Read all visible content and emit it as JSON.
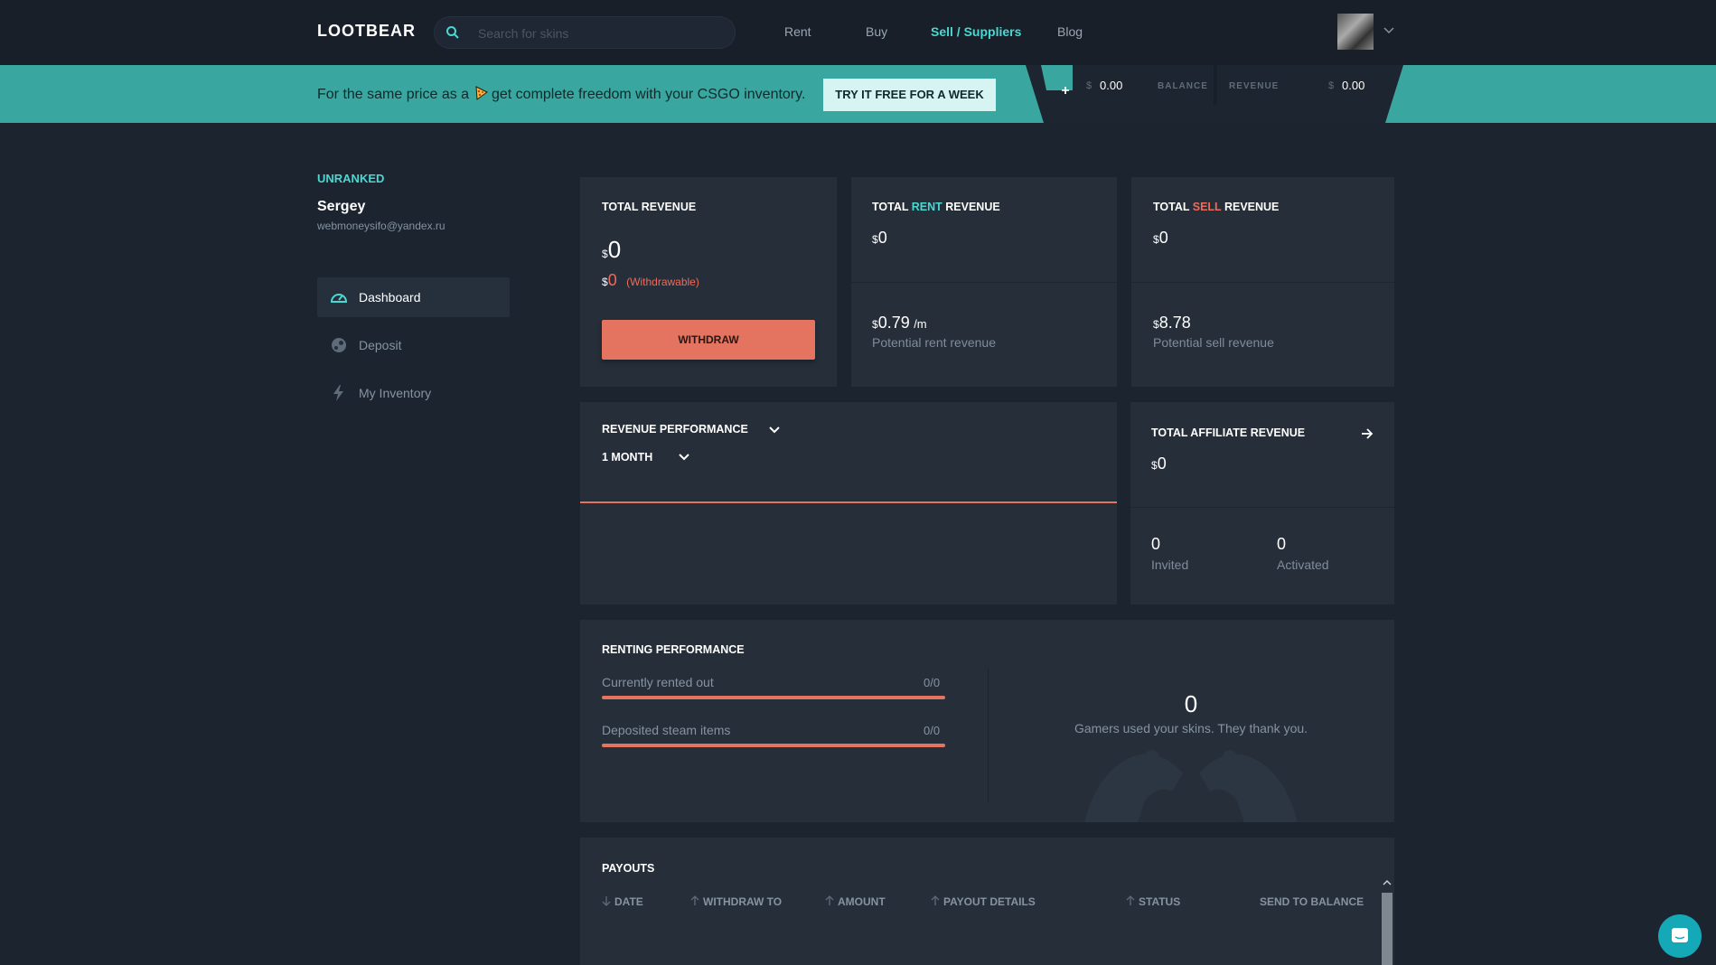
{
  "brand": {
    "logo": "LOOTBEAR"
  },
  "search": {
    "placeholder": "Search for skins"
  },
  "nav": {
    "items": [
      "Rent",
      "Buy",
      "Sell / Suppliers",
      "Blog"
    ]
  },
  "promo": {
    "text_before": "For the same price as a",
    "text_after": "get complete freedom with your CSGO inventory.",
    "button": "TRY IT FREE FOR A WEEK"
  },
  "wallet": {
    "plus": "+",
    "currency": "$",
    "balance_value": "0.00",
    "balance_label": "BALANCE",
    "revenue_label": "REVENUE",
    "revenue_value": "0.00"
  },
  "user": {
    "rank": "UNRANKED",
    "name": "Sergey",
    "email": "webmoneysifo@yandex.ru"
  },
  "sidebar": {
    "items": [
      "Dashboard",
      "Deposit",
      "My Inventory"
    ]
  },
  "total_revenue": {
    "title": "TOTAL REVENUE",
    "currency": "$",
    "value": "0",
    "withdrawable_value": "0",
    "withdrawable_label": "(Withdrawable)",
    "button": "WITHDRAW"
  },
  "rent_revenue": {
    "title_prefix": "TOTAL ",
    "title_accent": "RENT",
    "title_suffix": " REVENUE",
    "currency": "$",
    "value": "0",
    "potential_value": "0.79",
    "potential_unit": "/m",
    "potential_label": "Potential rent revenue"
  },
  "sell_revenue": {
    "title_prefix": "TOTAL ",
    "title_accent": "SELL",
    "title_suffix": " REVENUE",
    "currency": "$",
    "value": "0",
    "potential_value": "8.78",
    "potential_label": "Potential sell revenue"
  },
  "revenue_performance": {
    "title": "REVENUE PERFORMANCE",
    "period": "1 MONTH"
  },
  "affiliate": {
    "title": "TOTAL AFFILIATE REVENUE",
    "currency": "$",
    "value": "0",
    "invited_value": "0",
    "invited_label": "Invited",
    "activated_value": "0",
    "activated_label": "Activated"
  },
  "renting_performance": {
    "title": "RENTING PERFORMANCE",
    "rows": [
      {
        "label": "Currently rented out",
        "value": "0/0"
      },
      {
        "label": "Deposited steam items",
        "value": "0/0"
      }
    ],
    "gamers_value": "0",
    "gamers_label": "Gamers used your skins. They thank you."
  },
  "payouts": {
    "title": "PAYOUTS",
    "columns": [
      "DATE",
      "WITHDRAW TO",
      "AMOUNT",
      "PAYOUT DETAILS",
      "STATUS",
      "SEND TO BALANCE"
    ]
  },
  "colors": {
    "accent_teal": "#4ad8d0",
    "accent_red": "#e4735f",
    "promo_bg": "#3aa6a0",
    "page_bg": "#1c2430",
    "card_bg": "#262e3a"
  }
}
